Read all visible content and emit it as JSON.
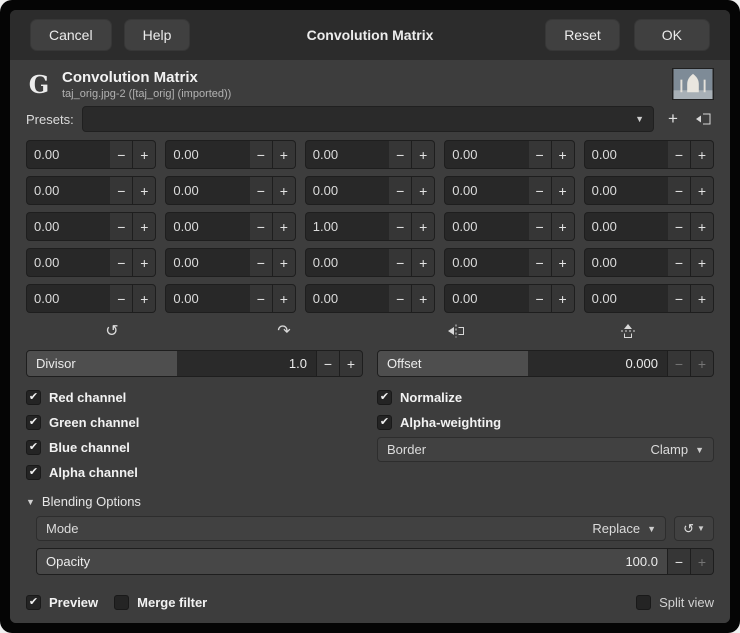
{
  "titlebar": {
    "title": "Convolution Matrix",
    "cancel": "Cancel",
    "help": "Help",
    "reset": "Reset",
    "ok": "OK"
  },
  "header": {
    "logo": "G",
    "title": "Convolution Matrix",
    "subtitle": "taj_orig.jpg-2 ([taj_orig] (imported))"
  },
  "presets": {
    "label": "Presets:",
    "value": ""
  },
  "matrix": {
    "values": [
      "0.00",
      "0.00",
      "0.00",
      "0.00",
      "0.00",
      "0.00",
      "0.00",
      "0.00",
      "0.00",
      "0.00",
      "0.00",
      "0.00",
      "1.00",
      "0.00",
      "0.00",
      "0.00",
      "0.00",
      "0.00",
      "0.00",
      "0.00",
      "0.00",
      "0.00",
      "0.00",
      "0.00",
      "0.00"
    ]
  },
  "divisor": {
    "label": "Divisor",
    "value": "1.0"
  },
  "offset": {
    "label": "Offset",
    "value": "0.000"
  },
  "channels": {
    "red": "Red channel",
    "green": "Green channel",
    "blue": "Blue channel",
    "alpha": "Alpha channel",
    "normalize": "Normalize",
    "alpha_weighting": "Alpha-weighting"
  },
  "border": {
    "label": "Border",
    "value": "Clamp"
  },
  "blending": {
    "label": "Blending Options",
    "mode_label": "Mode",
    "mode_value": "Replace",
    "opacity_label": "Opacity",
    "opacity_value": "100.0"
  },
  "footer": {
    "preview": "Preview",
    "merge": "Merge filter",
    "split": "Split view"
  },
  "icons": {
    "dropdown": "▼",
    "add": "+",
    "minus": "−",
    "plus": "+",
    "rotate_ccw": "↺",
    "rotate_cw": "↷",
    "reset": "↺",
    "expander_open": "▼",
    "check": "✔"
  },
  "colors": {
    "window_bg": "#3d3d3d",
    "titlebar_bg": "#2c2c2c",
    "field_bg": "#282828",
    "fill": "#4e4e4e",
    "text": "#ececec"
  }
}
